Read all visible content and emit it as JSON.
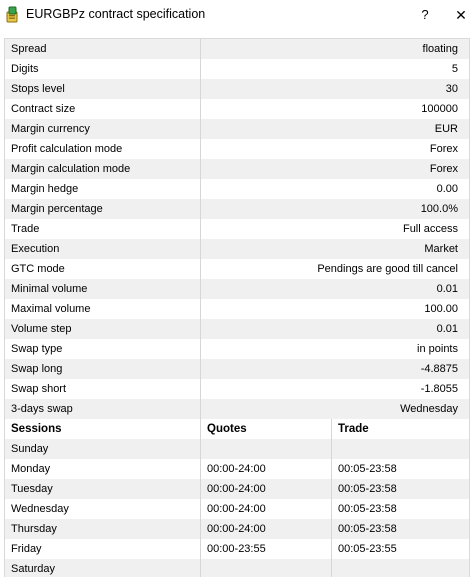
{
  "window": {
    "title": "EURGBPz contract specification",
    "help_label": "?",
    "close_label": "✕",
    "icon": "symbol-spec-icon"
  },
  "specs": [
    {
      "name": "Spread",
      "value": "floating"
    },
    {
      "name": "Digits",
      "value": "5"
    },
    {
      "name": "Stops level",
      "value": "30"
    },
    {
      "name": "Contract size",
      "value": "100000"
    },
    {
      "name": "Margin currency",
      "value": "EUR"
    },
    {
      "name": "Profit calculation mode",
      "value": "Forex"
    },
    {
      "name": "Margin calculation mode",
      "value": "Forex"
    },
    {
      "name": "Margin hedge",
      "value": "0.00"
    },
    {
      "name": "Margin percentage",
      "value": "100.0%"
    },
    {
      "name": "Trade",
      "value": "Full access"
    },
    {
      "name": "Execution",
      "value": "Market"
    },
    {
      "name": "GTC mode",
      "value": "Pendings are good till cancel"
    },
    {
      "name": "Minimal volume",
      "value": "0.01"
    },
    {
      "name": "Maximal volume",
      "value": "100.00"
    },
    {
      "name": "Volume step",
      "value": "0.01"
    },
    {
      "name": "Swap type",
      "value": "in points"
    },
    {
      "name": "Swap long",
      "value": "-4.8875"
    },
    {
      "name": "Swap short",
      "value": "-1.8055"
    },
    {
      "name": "3-days swap",
      "value": "Wednesday"
    }
  ],
  "sessions": {
    "headers": [
      "Sessions",
      "Quotes",
      "Trade"
    ],
    "rows": [
      {
        "day": "Sunday",
        "quotes": "",
        "trade": ""
      },
      {
        "day": "Monday",
        "quotes": "00:00-24:00",
        "trade": "00:05-23:58"
      },
      {
        "day": "Tuesday",
        "quotes": "00:00-24:00",
        "trade": "00:05-23:58"
      },
      {
        "day": "Wednesday",
        "quotes": "00:00-24:00",
        "trade": "00:05-23:58"
      },
      {
        "day": "Thursday",
        "quotes": "00:00-24:00",
        "trade": "00:05-23:58"
      },
      {
        "day": "Friday",
        "quotes": "00:00-23:55",
        "trade": "00:05-23:55"
      },
      {
        "day": "Saturday",
        "quotes": "",
        "trade": ""
      }
    ]
  }
}
